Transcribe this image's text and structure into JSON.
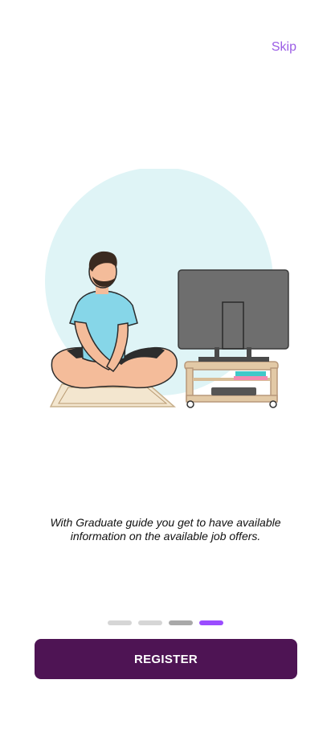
{
  "header": {
    "skip_label": "Skip"
  },
  "illustration": {
    "icon": "man-sitting-with-tv-illustration"
  },
  "caption": {
    "text": "With Graduate guide you get to have available information on the available job offers."
  },
  "pager": {
    "total": 4,
    "current": 4
  },
  "actions": {
    "register_label": "REGISTER"
  },
  "colors": {
    "accent": "#9b5de5",
    "button": "#4e1454",
    "active_dot": "#9b4dff",
    "circle": "#dff4f6"
  }
}
